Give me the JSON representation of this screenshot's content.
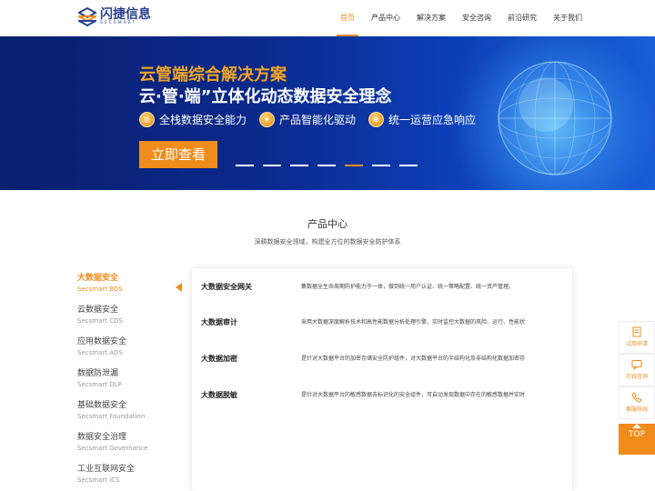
{
  "logo": {
    "cn": "闪捷信息",
    "en": "SECSMART"
  },
  "nav": [
    {
      "label": "首页",
      "active": true
    },
    {
      "label": "产品中心"
    },
    {
      "label": "解决方案"
    },
    {
      "label": "安全咨询"
    },
    {
      "label": "前沿研究"
    },
    {
      "label": "关于我们"
    }
  ],
  "banner": {
    "title": "云管端综合解决方案",
    "subtitle": "云·管·端”立体化动态数据安全理念",
    "features": [
      "全栈数据安全能力",
      "产品智能化驱动",
      "统一运营应急响应"
    ],
    "cta": "立即查看",
    "active_slide": 5,
    "slide_count": 7
  },
  "section": {
    "title": "产品中心",
    "subtitle": "深耕数据安全领域，构建全方位的数据安全防护体系"
  },
  "categories": [
    {
      "cn": "大数据安全",
      "en": "Secsmart BDS",
      "active": true
    },
    {
      "cn": "云数据安全",
      "en": "Secsmart CDS"
    },
    {
      "cn": "应用数据安全",
      "en": "Secsmart ADS"
    },
    {
      "cn": "数据防泄漏",
      "en": "Secsmart DLP"
    },
    {
      "cn": "基础数据安全",
      "en": "Secsmart Foundation"
    },
    {
      "cn": "数据安全治理",
      "en": "Secsmart Governance"
    },
    {
      "cn": "工业互联网安全",
      "en": "Secsmart ICS"
    }
  ],
  "products": [
    {
      "name": "大数据安全网关",
      "desc": "集数据全生命周期防护能力于一体，做到统一用户认证、统一策略配置、统一资产管理。"
    },
    {
      "name": "大数据审计",
      "desc": "采用大数据深度解析技术和高性能数据分析处理引擎，实时监控大数据的风险、运行、性能状"
    },
    {
      "name": "大数据加密",
      "desc": "是针对大数据平台的加密存储安全防护组件，对大数据平台的半结构化及非结构化数据加密存"
    },
    {
      "name": "大数据脱敏",
      "desc": "是针对大数据平台的敏感数据去标识化的安全组件，可自动发现数据中存在的敏感数据并实时"
    }
  ],
  "float_bar": {
    "items": [
      {
        "label": "试用申请",
        "icon": "apply-icon"
      },
      {
        "label": "在线咨询",
        "icon": "chat-icon"
      },
      {
        "label": "客服热线",
        "icon": "phone-icon"
      }
    ],
    "top": "TOP"
  },
  "colors": {
    "accent": "#f08c1c",
    "brand": "#2a3f8f",
    "banner": "#0b2a8c"
  }
}
